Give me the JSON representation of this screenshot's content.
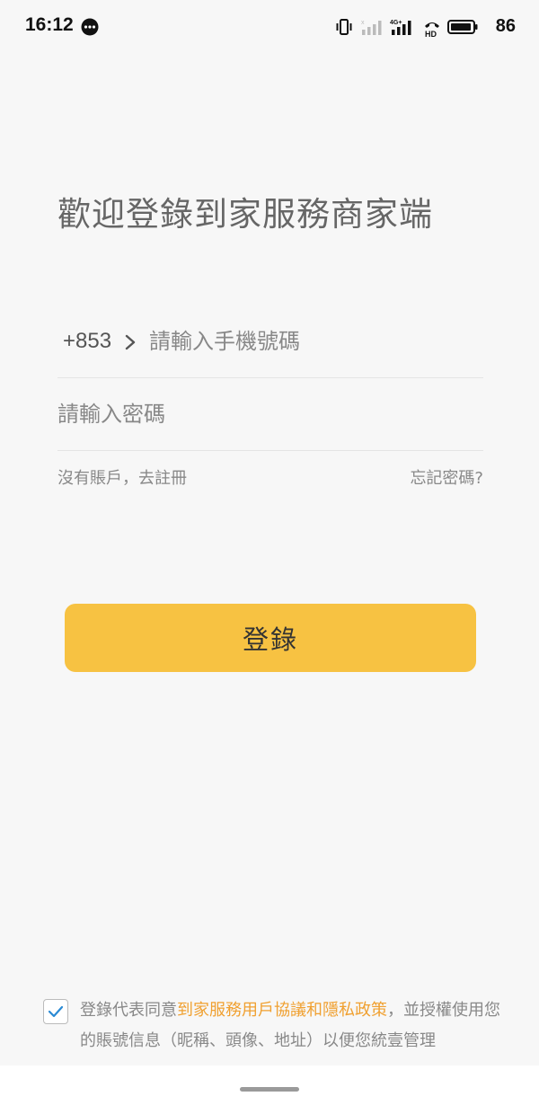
{
  "status_bar": {
    "time": "16:12",
    "battery_level": "86",
    "network_label": "4G+",
    "hd_label": "HD"
  },
  "login": {
    "title": "歡迎登錄到家服務商家端",
    "country_code": "+853",
    "phone_placeholder": "請輸入手機號碼",
    "phone_value": "",
    "password_placeholder": "請輸入密碼",
    "password_value": "",
    "register_link": "沒有賬戶，去註冊",
    "forgot_link": "忘記密碼?",
    "submit_label": "登錄"
  },
  "agreement": {
    "checked": true,
    "prefix": "登錄代表同意",
    "link_text": "到家服務用戶協議和隱私政策",
    "suffix": "，並授權使用您的賬號信息（昵稱、頭像、地址）以便您統壹管理"
  },
  "colors": {
    "accent": "#f7c242",
    "link": "#f0a030",
    "check": "#2a8ad4"
  }
}
